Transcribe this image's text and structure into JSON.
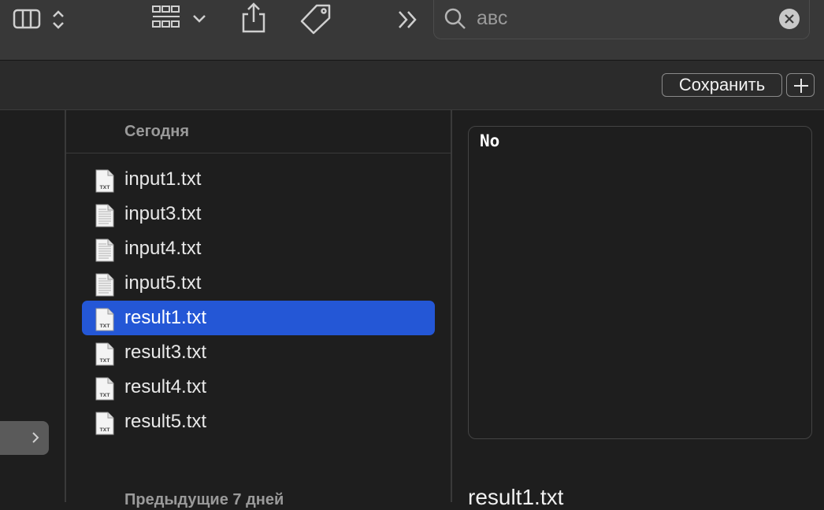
{
  "toolbar": {
    "icons": [
      "column-view-icon",
      "view-switch-chevron-icon",
      "group-grid-icon",
      "share-icon",
      "tag-icon",
      "more-chevrons-icon"
    ]
  },
  "search": {
    "value": "авс",
    "icon": "search-icon",
    "clear_icon": "clear-icon"
  },
  "actions": {
    "save_label": "Сохранить",
    "add_icon": "plus-icon"
  },
  "file_list": {
    "section_today": "Сегодня",
    "section_prev": "Предыдущие 7 дней",
    "files": [
      {
        "name": "input1.txt",
        "icon": "txt-file-icon",
        "selected": false
      },
      {
        "name": "input3.txt",
        "icon": "text-doc-icon",
        "selected": false
      },
      {
        "name": "input4.txt",
        "icon": "text-doc-icon",
        "selected": false
      },
      {
        "name": "input5.txt",
        "icon": "text-doc-icon",
        "selected": false
      },
      {
        "name": "result1.txt",
        "icon": "txt-file-icon",
        "selected": true
      },
      {
        "name": "result3.txt",
        "icon": "txt-file-icon",
        "selected": false
      },
      {
        "name": "result4.txt",
        "icon": "txt-file-icon",
        "selected": false
      },
      {
        "name": "result5.txt",
        "icon": "txt-file-icon",
        "selected": false
      }
    ]
  },
  "preview": {
    "content": "No",
    "file_name": "result1.txt"
  },
  "colors": {
    "selection": "#2457d6",
    "toolbar": "#383838"
  }
}
